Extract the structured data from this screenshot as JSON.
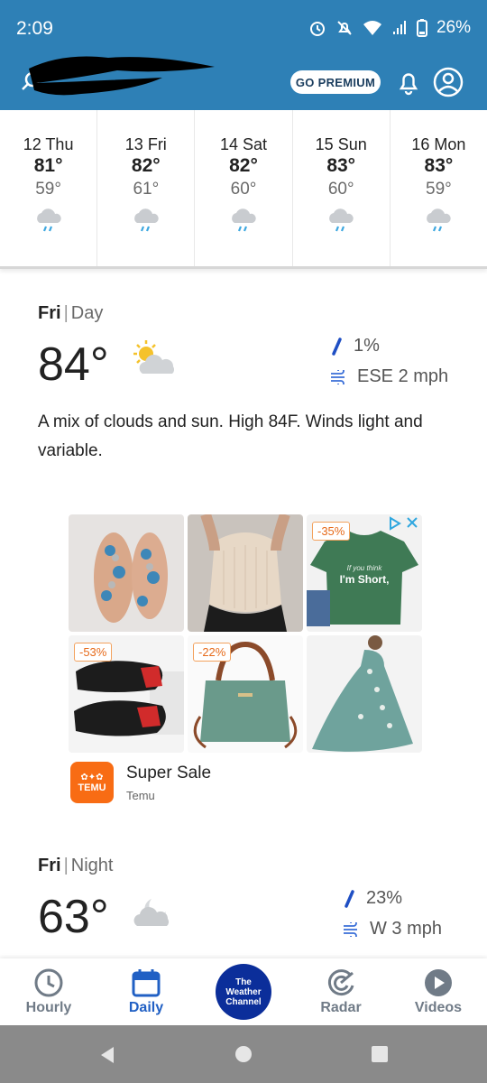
{
  "status_bar": {
    "time": "2:09",
    "battery": "26%"
  },
  "header": {
    "premium_label": "GO PREMIUM"
  },
  "forecast": [
    {
      "label": "12 Thu",
      "high": "81°",
      "low": "59°",
      "icon": "rain-cloud-icon"
    },
    {
      "label": "13 Fri",
      "high": "82°",
      "low": "61°",
      "icon": "rain-cloud-icon"
    },
    {
      "label": "14 Sat",
      "high": "82°",
      "low": "60°",
      "icon": "rain-cloud-icon"
    },
    {
      "label": "15 Sun",
      "high": "83°",
      "low": "60°",
      "icon": "rain-cloud-icon"
    },
    {
      "label": "16 Mon",
      "high": "83°",
      "low": "59°",
      "icon": "rain-cloud-icon"
    }
  ],
  "day_detail": {
    "day": "Fri",
    "period": "Day",
    "temp": "84°",
    "precip": "1%",
    "wind": "ESE 2 mph",
    "description": "A mix of clouds and sun. High 84F. Winds light and variable."
  },
  "ad": {
    "title": "Super Sale",
    "advertiser": "Temu",
    "logo_text": "TEMU",
    "discounts": [
      "-35%",
      "-53%",
      "-22%"
    ],
    "shirt_text_1": "If you think",
    "shirt_text_2": "I'm Short,"
  },
  "night_detail": {
    "day": "Fri",
    "period": "Night",
    "temp": "63°",
    "precip": "23%",
    "wind": "W 3 mph"
  },
  "bottom_nav": {
    "hourly": "Hourly",
    "daily": "Daily",
    "logo_line1": "The",
    "logo_line2": "Weather",
    "logo_line3": "Channel",
    "radar": "Radar",
    "videos": "Videos"
  },
  "colors": {
    "header_bg": "#2e80b6",
    "active_nav": "#2160c4",
    "brand_blue": "#0b2e9a",
    "temu_orange": "#f86c14"
  }
}
